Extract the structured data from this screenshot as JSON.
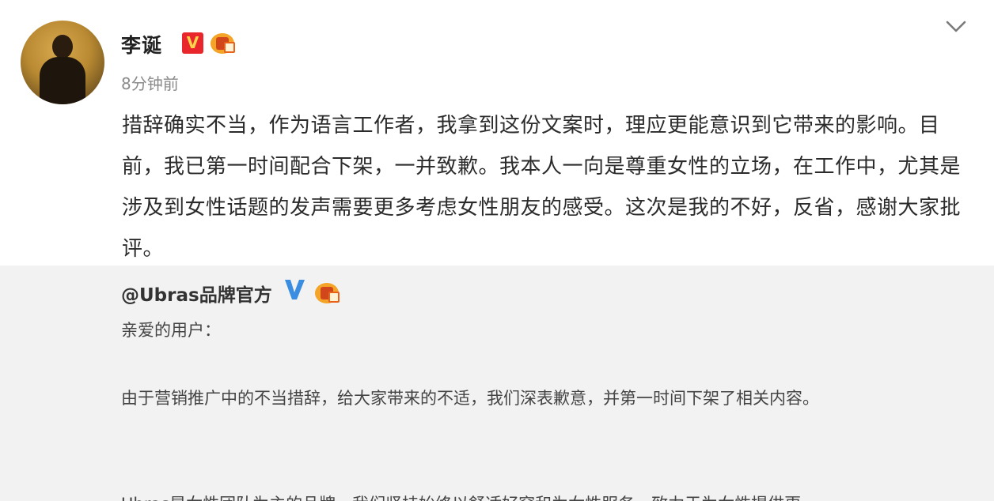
{
  "post": {
    "username": "李诞",
    "verified_badge": "V",
    "medal_icon": "gold-medal-icon",
    "time": "8分钟前",
    "menu_icon": "chevron-down-icon",
    "content": "措辞确实不当，作为语言工作者，我拿到这份文案时，理应更能意识到它带来的影响。目前，我已第一时间配合下架，一并致歉。我本人一向是尊重女性的立场，在工作中，尤其是涉及到女性话题的发声需要更多考虑女性朋友的感受。这次是我的不好，反省，感谢大家批评。"
  },
  "repost": {
    "username": "@Ubras品牌官方",
    "verified_icon": "blue-v-icon",
    "medal_icon": "gold-medal-icon",
    "salutation": "亲爱的用户：",
    "body": "由于营销推广中的不当措辞，给大家带来的不适，我们深表歉意，并第一时间下架了相关内容。",
    "next_line_partial": "Ubras是女性团队为主的品牌，我们坚持始终以舒适好穿和为女性服务，致力于为女性提供更"
  },
  "colors": {
    "verified_red": "#e8262b",
    "verified_blue": "#3a8de0",
    "medal": "#f4a426",
    "repost_background": "#f2f2f3"
  }
}
